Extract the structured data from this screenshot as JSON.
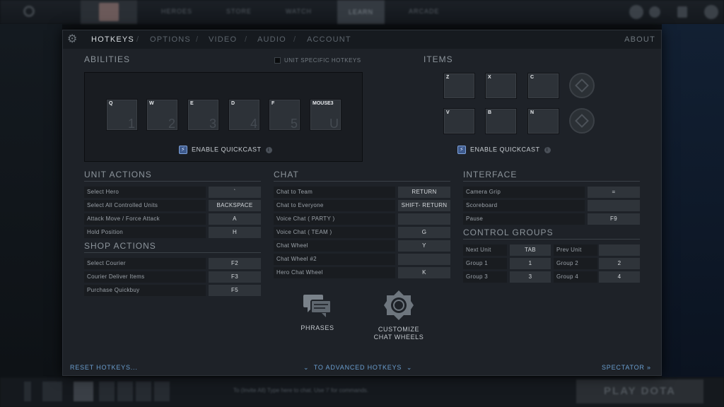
{
  "background": {
    "nav": [
      "HEROES",
      "STORE",
      "WATCH",
      "LEARN",
      "ARCADE"
    ],
    "chat_hint": "To (Invite All) Type here to chat. Use '/' for commands.",
    "play_label": "PLAY DOTA"
  },
  "tabs": {
    "items": [
      "HOTKEYS",
      "OPTIONS",
      "VIDEO",
      "AUDIO",
      "ACCOUNT"
    ],
    "active": "HOTKEYS",
    "about": "ABOUT"
  },
  "abilities": {
    "title": "ABILITIES",
    "unit_specific": "UNIT SPECIFIC HOTKEYS",
    "slots": [
      {
        "key": "Q",
        "num": "1"
      },
      {
        "key": "W",
        "num": "2"
      },
      {
        "key": "E",
        "num": "3"
      },
      {
        "key": "D",
        "num": "4"
      },
      {
        "key": "F",
        "num": "5"
      },
      {
        "key": "MOUSE3",
        "num": "U"
      }
    ],
    "quickcast": "ENABLE QUICKCAST"
  },
  "items": {
    "title": "ITEMS",
    "slots": [
      "Z",
      "X",
      "C",
      "V",
      "B",
      "N"
    ],
    "quickcast": "ENABLE QUICKCAST"
  },
  "unit_actions": {
    "title": "UNIT ACTIONS",
    "rows": [
      {
        "label": "Select Hero",
        "key": "`"
      },
      {
        "label": "Select All Controlled Units",
        "key": "BACKSPACE"
      },
      {
        "label": "Attack Move / Force Attack",
        "key": "A"
      },
      {
        "label": "Hold Position",
        "key": "H"
      }
    ]
  },
  "shop_actions": {
    "title": "SHOP ACTIONS",
    "rows": [
      {
        "label": "Select Courier",
        "key": "F2"
      },
      {
        "label": "Courier Deliver Items",
        "key": "F3"
      },
      {
        "label": "Purchase Quickbuy",
        "key": "F5"
      }
    ]
  },
  "chat": {
    "title": "CHAT",
    "rows": [
      {
        "label": "Chat to Team",
        "key": "RETURN"
      },
      {
        "label": "Chat to Everyone",
        "key": "SHIFT- RETURN"
      },
      {
        "label": "Voice Chat ( PARTY )",
        "key": ""
      },
      {
        "label": "Voice Chat ( TEAM )",
        "key": "G"
      },
      {
        "label": "Chat Wheel",
        "key": "Y"
      },
      {
        "label": "Chat Wheel #2",
        "key": ""
      },
      {
        "label": "Hero Chat Wheel",
        "key": "K"
      }
    ],
    "phrases": "PHRASES",
    "customize_line1": "CUSTOMIZE",
    "customize_line2": "CHAT WHEELS"
  },
  "interface": {
    "title": "INTERFACE",
    "rows": [
      {
        "label": "Camera Grip",
        "key": "="
      },
      {
        "label": "Scoreboard",
        "key": ""
      },
      {
        "label": "Pause",
        "key": "F9"
      }
    ]
  },
  "control_groups": {
    "title": "CONTROL GROUPS",
    "rows": [
      {
        "l1": "Next Unit",
        "k1": "TAB",
        "l2": "Prev Unit",
        "k2": ""
      },
      {
        "l1": "Group 1",
        "k1": "1",
        "l2": "Group 2",
        "k2": "2"
      },
      {
        "l1": "Group 3",
        "k1": "3",
        "l2": "Group 4",
        "k2": "4"
      }
    ]
  },
  "footer": {
    "reset": "RESET HOTKEYS...",
    "advanced": "TO ADVANCED HOTKEYS",
    "spectator": "SPECTATOR"
  },
  "colors": {
    "panel": "#1e2228",
    "link": "#6a9ecf",
    "quickcast_icon": "#3e5a8c"
  }
}
